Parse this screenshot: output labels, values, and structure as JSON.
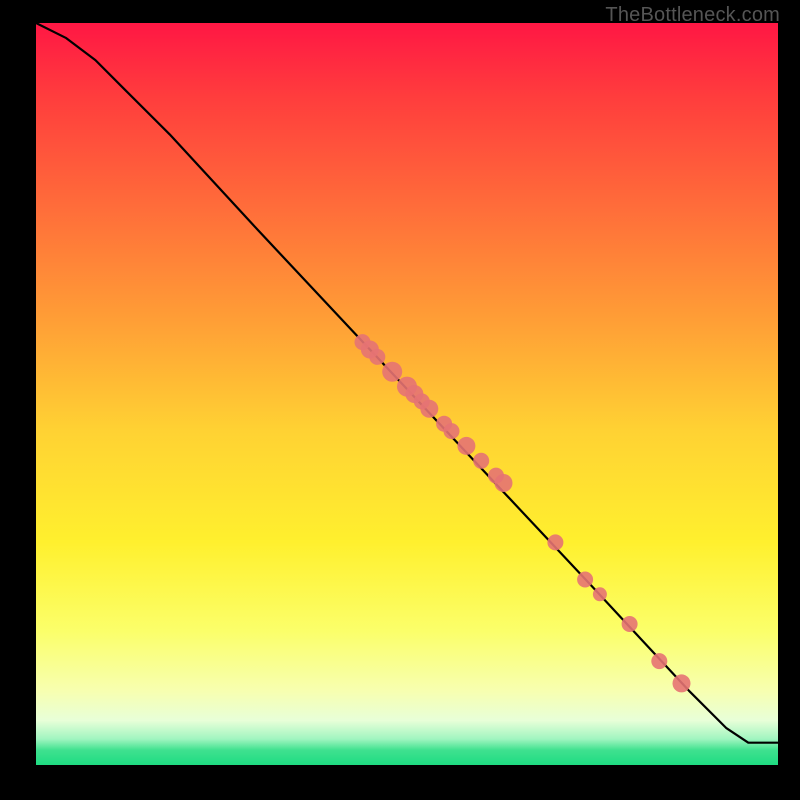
{
  "watermark": "TheBottleneck.com",
  "chart_data": {
    "type": "line",
    "title": "",
    "xlabel": "",
    "ylabel": "",
    "xlim": [
      0,
      100
    ],
    "ylim": [
      0,
      100
    ],
    "curve": {
      "x": [
        0,
        4,
        8,
        12,
        18,
        30,
        45,
        60,
        75,
        88,
        93,
        96,
        100
      ],
      "y": [
        100,
        98,
        95,
        91,
        85,
        72,
        56,
        40,
        24,
        10,
        5,
        3,
        3
      ]
    },
    "series": [
      {
        "name": "points-on-curve",
        "x": [
          44,
          45,
          46,
          48,
          50,
          51,
          52,
          53,
          55,
          56,
          58,
          60,
          62,
          63,
          70,
          74,
          76,
          80,
          84,
          87
        ],
        "y": [
          57,
          56,
          55,
          53,
          51,
          50,
          49,
          48,
          46,
          45,
          43,
          41,
          39,
          38,
          30,
          25,
          23,
          19,
          14,
          11
        ],
        "r": [
          8,
          9,
          8,
          10,
          10,
          9,
          8,
          9,
          8,
          8,
          9,
          8,
          8,
          9,
          8,
          8,
          7,
          8,
          8,
          9
        ]
      }
    ],
    "background_gradient": {
      "top": "#ff1744",
      "mid": "#ffe629",
      "bottom": "#1edc82"
    }
  }
}
